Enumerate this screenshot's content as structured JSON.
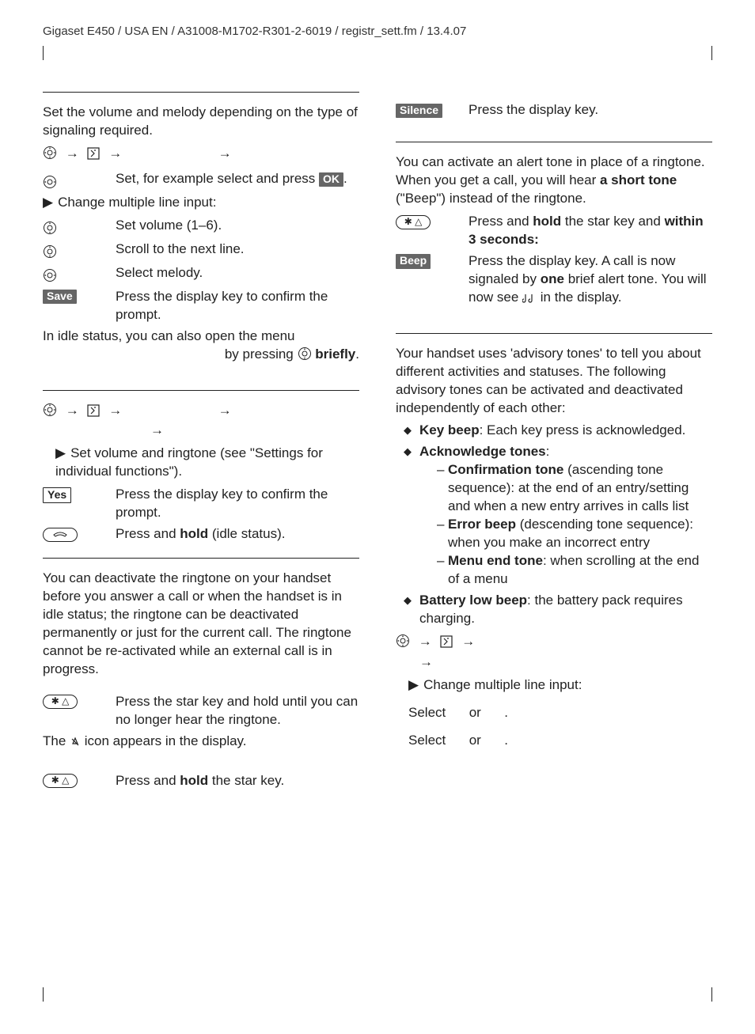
{
  "header": "Gigaset E450 / USA EN / A31008-M1702-R301-2-6019 / registr_sett.fm / 13.4.07",
  "left": {
    "p1": "Set the volume and melody depending on the type of signaling required.",
    "set_example_a": "Set, for example select ",
    "set_example_b": " and press ",
    "set_example_c": ".",
    "change_multi": "Change multiple line input:",
    "set_volume": "Set volume (1–6).",
    "scroll_next": "Scroll to the next line.",
    "select_melody": "Select melody.",
    "save_label": "Save",
    "save_text": "Press the display key to confirm the prompt.",
    "idle_line_a": "In idle status, you can also open the menu ",
    "idle_line_b": " by pressing ",
    "idle_line_c": "briefly",
    "idle_line_d": ".",
    "sec2_bullet": "Set volume and ringtone (see \"Settings for individual functions\").",
    "yes_label": "Yes",
    "yes_text": "Press the display key to confirm the prompt.",
    "hold_text_a": "Press and ",
    "hold_text_b": "hold",
    "hold_text_c": " (idle status).",
    "sec3_intro": "You can deactivate the ringtone on your handset before you answer a call or when the handset is in idle status; the ringtone can be deactivated permanently or just for the current call. The ringtone cannot be re-activated while an external call is in progress.",
    "star_text": "Press the star key and hold until you can no longer hear the ringtone.",
    "icon_line_a": "The ",
    "icon_line_b": " icon appears in the display.",
    "star2_a": "Press and ",
    "star2_b": "hold",
    "star2_c": " the star key."
  },
  "right": {
    "silence_label": "Silence",
    "silence_text": "Press the display key.",
    "alert_p_a": "You can activate an alert tone in place of a ringtone. When you get a call, you will hear ",
    "alert_p_b": "a short tone",
    "alert_p_c": " (\"Beep\") instead of the ringtone.",
    "hold_star_a": "Press and ",
    "hold_star_b": "hold",
    "hold_star_c": " the star key and ",
    "hold_star_d": "within 3 seconds:",
    "beep_label": "Beep",
    "beep_a": "Press the display key. A call is now signaled by ",
    "beep_b": "one",
    "beep_c": " brief alert tone. You will now see ",
    "beep_d": " in the display.",
    "adv_intro": "Your handset uses 'advisory tones' to tell you about different activities and statuses. The following advisory tones can be activated and deactivated independently of each other:",
    "keybeep_a": "Key beep",
    "keybeep_b": ": Each key press is acknowledged.",
    "ack_a": "Acknowledge tones",
    "ack_b": ":",
    "conf_a": "Confirmation tone",
    "conf_b": " (ascending tone sequence): at the end of an entry/setting and when a new entry arrives in calls list",
    "err_a": "Error beep",
    "err_b": " (descending tone sequence): when you make an incorrect entry",
    "menu_a": "Menu end tone",
    "menu_b": ": when scrolling at the end of a menu",
    "bat_a": "Battery low beep",
    "bat_b": ": the battery pack requires charging.",
    "change2": "Change multiple line input:",
    "sel1_a": "Select ",
    "sel1_b": " or ",
    "sel1_c": ".",
    "sel2_a": "Select ",
    "sel2_b": " or ",
    "sel2_c": "."
  },
  "labels": {
    "ok": "OK"
  }
}
